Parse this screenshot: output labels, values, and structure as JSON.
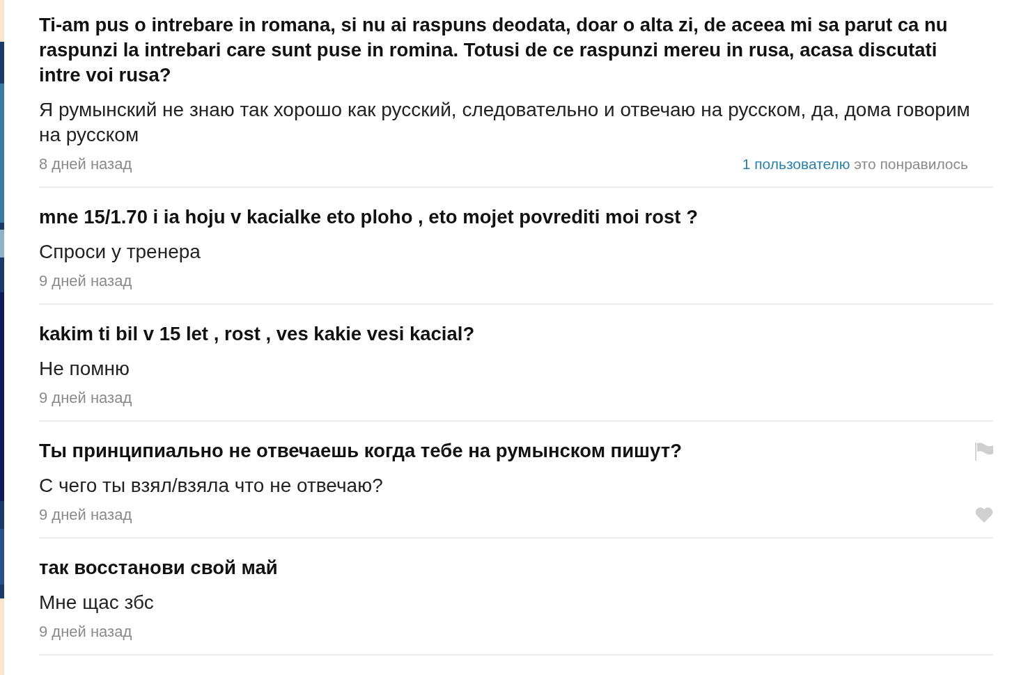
{
  "answers": [
    {
      "question": "Ti-am pus o intrebare in romana, si nu ai raspuns deodata, doar o alta zi, de aceea mi sa parut ca nu raspunzi la intrebari care sunt puse in romina. Totusi de ce raspunzi mereu in rusa, acasa discutati intre voi rusa?",
      "answer": "Я румынский не знаю так хорошо как русский, следовательно и отвечаю на русском, да, дома говорим на русском",
      "time": "8 дней назад",
      "likes": {
        "link": "1 пользователю",
        "text": "это понравилось"
      },
      "actions_visible": false
    },
    {
      "question": "mne 15/1.70 i ia hoju v kacialke eto ploho , eto mojet povrediti moi rost ?",
      "answer": "Спроси у тренера",
      "time": "9 дней назад",
      "actions_visible": false
    },
    {
      "question": "kakim ti bil v 15 let , rost , ves kakie vesi kacial?",
      "answer": "Не помню",
      "time": "9 дней назад",
      "actions_visible": false
    },
    {
      "question": "Ты принципиально не отвечаешь когда тебе на румынском пишут?",
      "answer": "С чего ты взял/взяла что не отвечаю?",
      "time": "9 дней назад",
      "actions_visible": true
    },
    {
      "question": "так восстанови свой май",
      "answer": "Мне щас збс",
      "time": "9 дней назад",
      "actions_visible": false
    }
  ]
}
